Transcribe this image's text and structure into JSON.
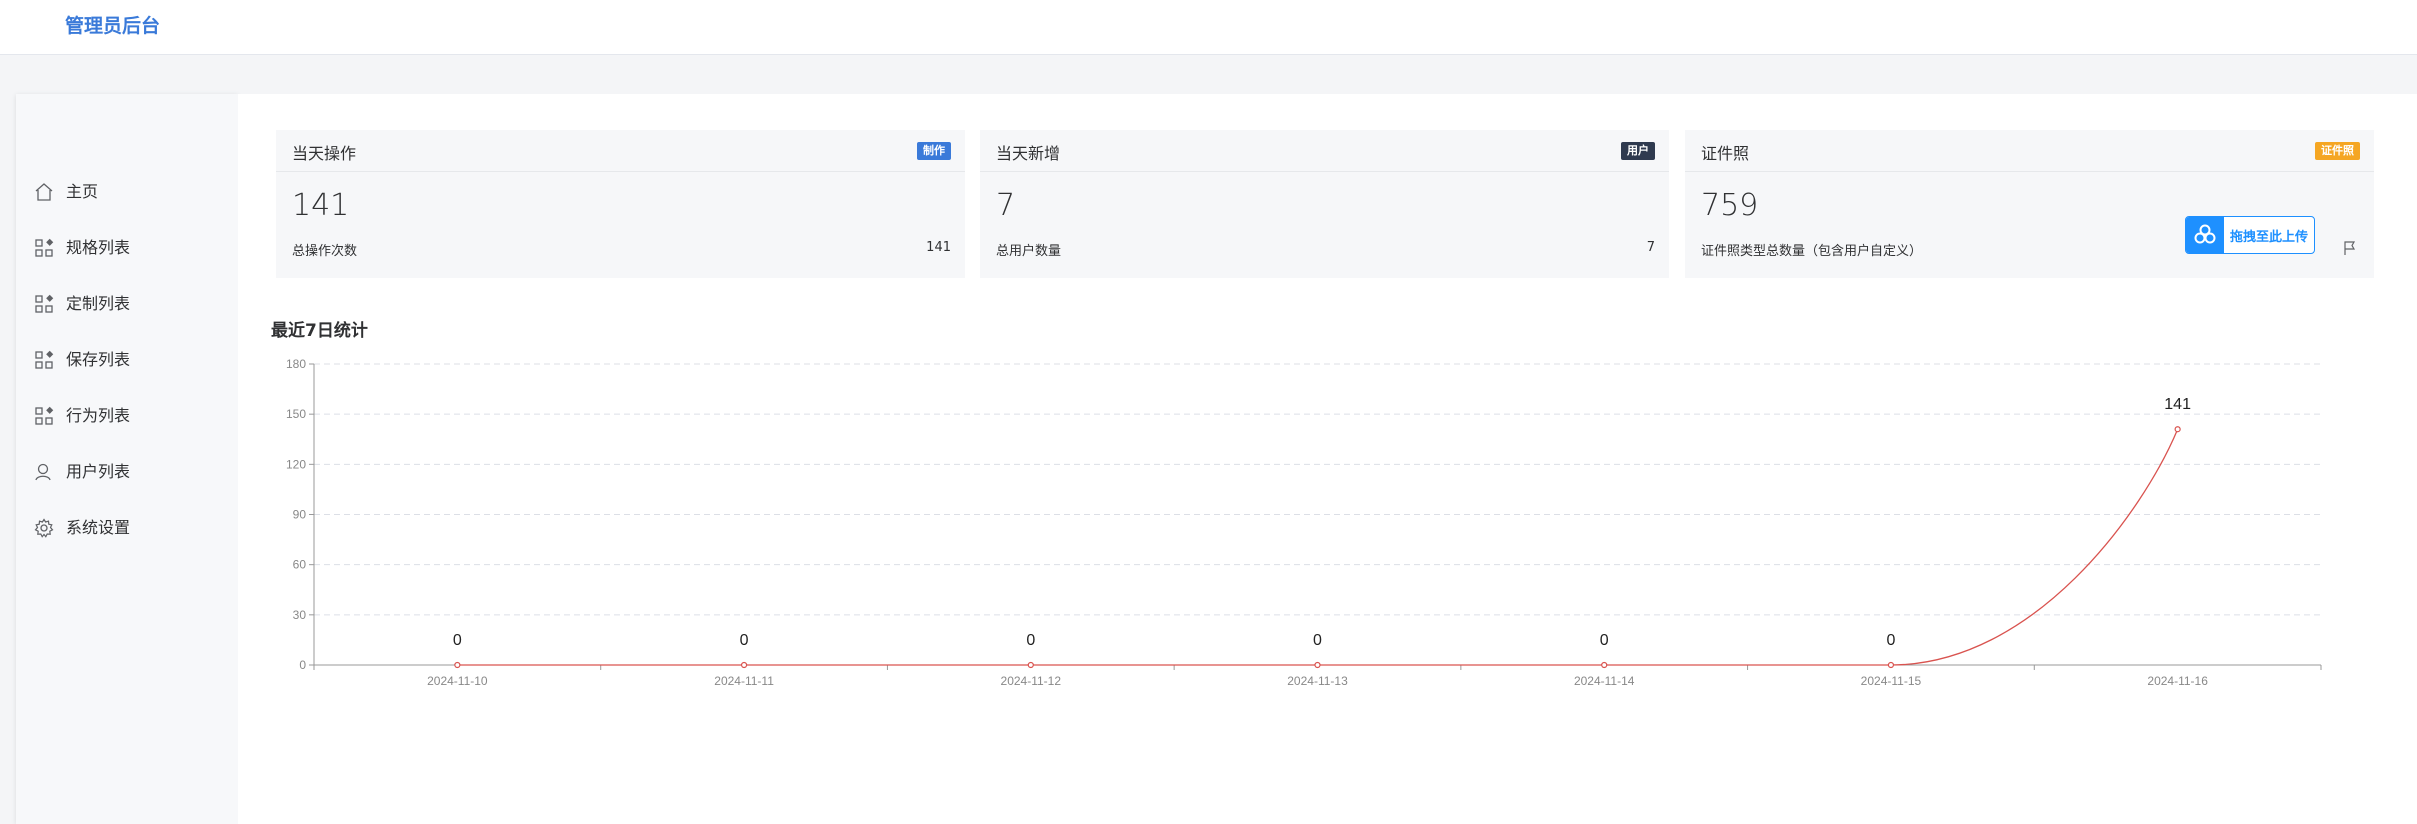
{
  "app": {
    "title": "管理员后台"
  },
  "sidebar": {
    "items": [
      {
        "label": "主页",
        "icon": "home-icon"
      },
      {
        "label": "规格列表",
        "icon": "grid-icon"
      },
      {
        "label": "定制列表",
        "icon": "grid-icon"
      },
      {
        "label": "保存列表",
        "icon": "grid-icon"
      },
      {
        "label": "行为列表",
        "icon": "grid-icon"
      },
      {
        "label": "用户列表",
        "icon": "user-icon"
      },
      {
        "label": "系统设置",
        "icon": "gear-icon"
      }
    ]
  },
  "cards": [
    {
      "title": "当天操作",
      "badge": "制作",
      "badge_color": "#3a7ad9",
      "value": "141",
      "sub_label": "总操作次数",
      "sub_value": "141"
    },
    {
      "title": "当天新增",
      "badge": "用户",
      "badge_color": "#2f3a4f",
      "value": "7",
      "sub_label": "总用户数量",
      "sub_value": "7"
    },
    {
      "title": "证件照",
      "badge": "证件照",
      "badge_color": "#f5a623",
      "value": "759",
      "sub_label": "证件照类型总数量（包含用户自定义）",
      "upload_label": "拖拽至此上传"
    }
  ],
  "section": {
    "title": "最近7日统计"
  },
  "chart_data": {
    "type": "line",
    "categories": [
      "2024-11-10",
      "2024-11-11",
      "2024-11-12",
      "2024-11-13",
      "2024-11-14",
      "2024-11-15",
      "2024-11-16"
    ],
    "series": [
      {
        "values": [
          0,
          0,
          0,
          0,
          0,
          0,
          141
        ],
        "color": "#d9534f"
      }
    ],
    "ylim": [
      0,
      180
    ],
    "yticks": [
      0,
      30,
      60,
      90,
      120,
      150,
      180
    ],
    "grid": true,
    "data_labels": true
  }
}
